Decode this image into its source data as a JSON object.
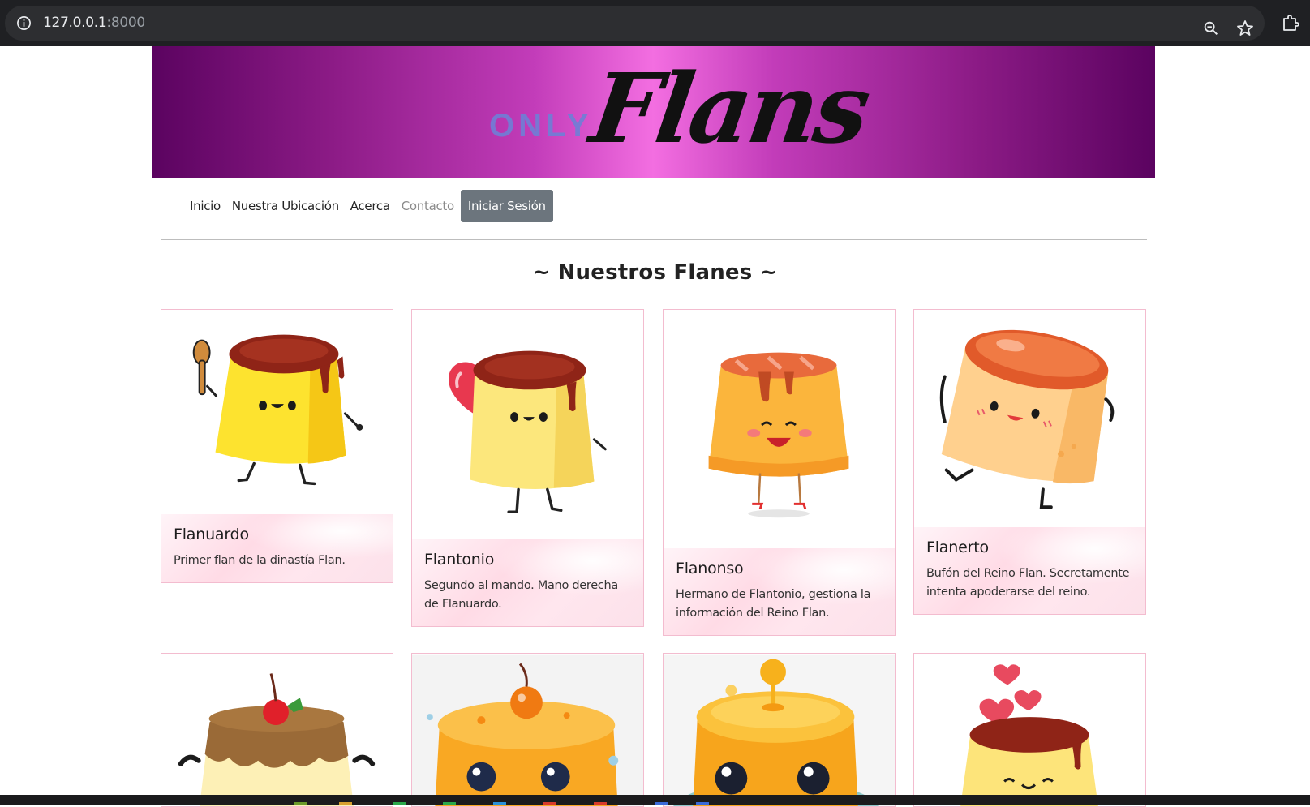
{
  "browser": {
    "url_host": "127.0.0.1",
    "url_port": ":8000"
  },
  "banner": {
    "logo_small": "ONLY",
    "logo_script": "Flans"
  },
  "nav": {
    "items": [
      {
        "label": "Inicio"
      },
      {
        "label": "Nuestra Ubicación"
      },
      {
        "label": "Acerca"
      },
      {
        "label": "Contacto"
      }
    ],
    "login_label": "Iniciar Sesión"
  },
  "section": {
    "title": "~ Nuestros Flanes ~"
  },
  "cards": [
    {
      "title": "Flanuardo",
      "text": "Primer flan de la dinastía Flan."
    },
    {
      "title": "Flantonio",
      "text": "Segundo al mando. Mano derecha de Flanuardo."
    },
    {
      "title": "Flanonso",
      "text": "Hermano de Flantonio, gestiona la información del Reino Flan."
    },
    {
      "title": "Flanerto",
      "text": "Bufón del Reino Flan. Secretamente intenta apoderarse del reino."
    }
  ],
  "colors": {
    "banner_center": "#f36ee1",
    "banner_edge": "#5b0360",
    "login_button": "#6c757d",
    "card_border": "#f3bccf"
  }
}
